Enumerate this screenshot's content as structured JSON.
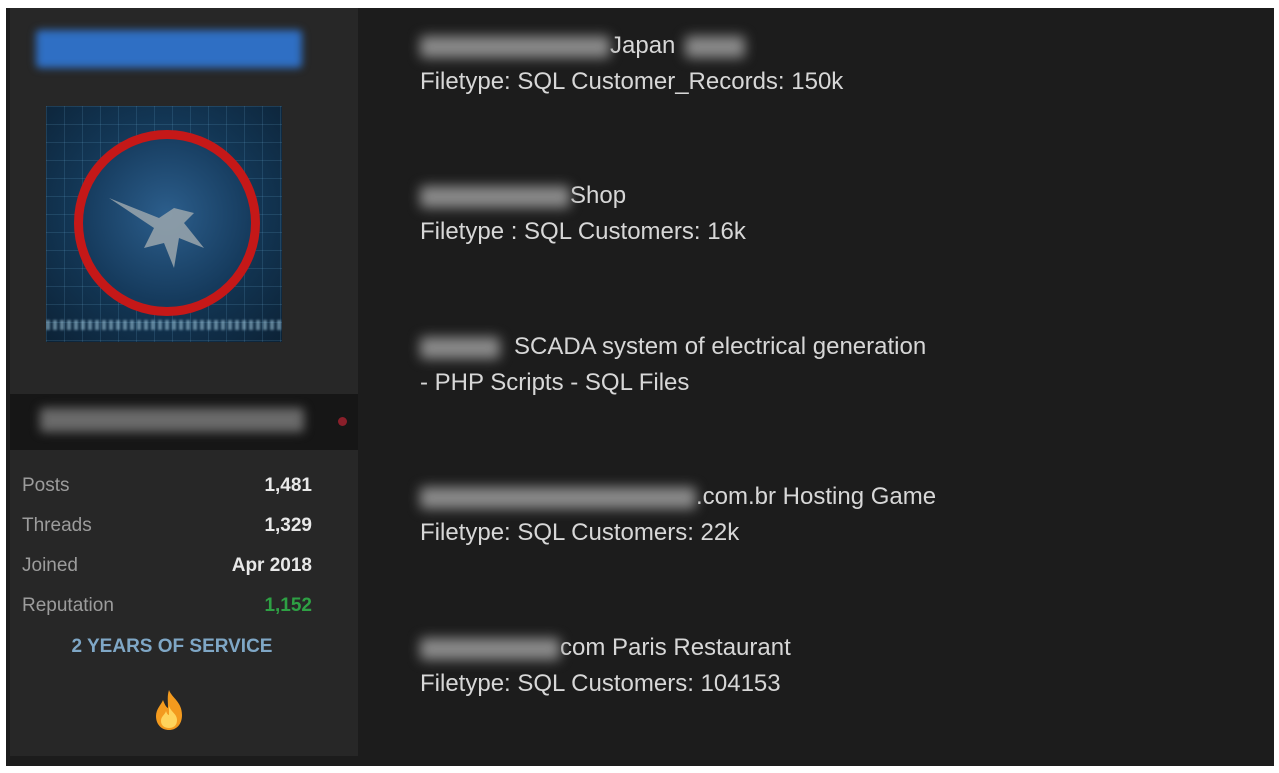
{
  "profile": {
    "stats": [
      {
        "label": "Posts",
        "value": "1,481"
      },
      {
        "label": "Threads",
        "value": "1,329"
      },
      {
        "label": "Joined",
        "value": "Apr 2018"
      },
      {
        "label": "Reputation",
        "value": "1,152"
      }
    ],
    "service_badge": "2 YEARS OF SERVICE",
    "reputation_color": "#2ea044",
    "user_bar_color": "#2f6fc4",
    "badge_icon": "flame-icon"
  },
  "listings": [
    {
      "title": "Japan",
      "subtitle": "Filetype: SQL Customer_Records: 150k"
    },
    {
      "title": "Shop",
      "subtitle": "Filetype : SQL Customers: 16k"
    },
    {
      "title": "SCADA system of electrical generation",
      "subtitle": "- PHP Scripts - SQL Files"
    },
    {
      "title": ".com.br Hosting Game",
      "subtitle": "Filetype: SQL Customers: 22k"
    },
    {
      "title": "com Paris Restaurant",
      "subtitle": "Filetype: SQL Customers: 104153"
    }
  ]
}
